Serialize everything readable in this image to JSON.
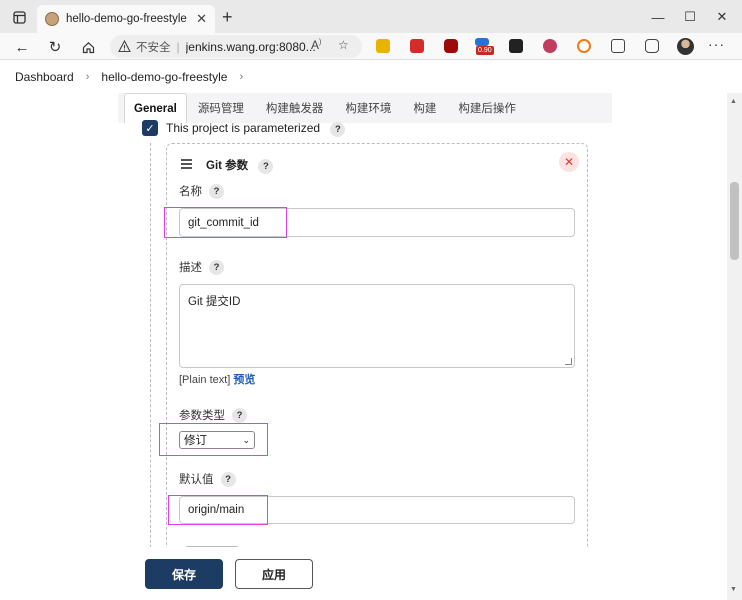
{
  "browser": {
    "tab_title": "hello-demo-go-freestyle Config",
    "security_label": "不安全",
    "url": "jenkins.wang.org:8080...",
    "ext_badge": "0.90"
  },
  "breadcrumb": [
    "Dashboard",
    "hello-demo-go-freestyle"
  ],
  "config_tabs": [
    "General",
    "源码管理",
    "构建触发器",
    "构建环境",
    "构建",
    "构建后操作"
  ],
  "general": {
    "parameterized_label": "This project is parameterized"
  },
  "git_param": {
    "title": "Git 参数",
    "name_label": "名称",
    "name_value": "git_commit_id",
    "desc_label": "描述",
    "desc_value": "Git  提交ID",
    "plain_text": "[Plain text]",
    "preview_label": "预览",
    "type_label": "参数类型",
    "type_value": "修订",
    "default_label": "默认值",
    "default_value": "origin/main"
  },
  "actions": {
    "save_label": "保存",
    "apply_label": "应用"
  },
  "colors": {
    "primary": "#1c3c63",
    "highlight": "#e040e0",
    "link": "#1f5fbf"
  }
}
